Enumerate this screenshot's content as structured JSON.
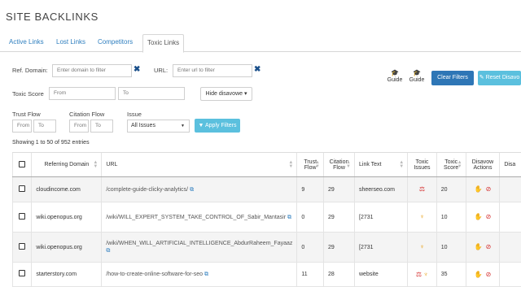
{
  "page_title": "SITE BACKLINKS",
  "tabs": [
    {
      "label": "Active Links",
      "active": false
    },
    {
      "label": "Lost Links",
      "active": false
    },
    {
      "label": "Competitors",
      "active": false
    },
    {
      "label": "Toxic Links",
      "active": true
    }
  ],
  "filters": {
    "ref_domain_label": "Ref. Domain:",
    "ref_domain_placeholder": "Enter domain to filter",
    "url_label": "URL:",
    "url_placeholder": "Enter url to filter",
    "toxic_score_label": "Toxic Score",
    "toxic_from_placeholder": "From",
    "toxic_to_placeholder": "To",
    "trust_flow_label": "Trust Flow",
    "citation_flow_label": "Citation Flow",
    "from_placeholder": "From",
    "to_placeholder": "To",
    "issue_label": "Issue",
    "issue_selected": "All Issues",
    "hide_disavowed_label": "Hide disavowe ▾",
    "apply_filters_label": "▼ Apply Filters"
  },
  "toolbar": {
    "guide1": "Guide",
    "guide2": "Guide",
    "clear_filters": "Clear Filters",
    "reset_disavow": "✎ Reset Disavo"
  },
  "entries_text": "Showing 1 to 50 of 952 entries",
  "table": {
    "headers": [
      "Referring Domain",
      "URL",
      "Trust Flow",
      "Citation Flow",
      "Link Text",
      "Toxic Issues",
      "Toxic Score",
      "Disavow Actions",
      "Disa"
    ],
    "rows": [
      {
        "domain": "cloudincome.com",
        "url": "/complete-guide-clicky-analytics/",
        "trust": "9",
        "citation": "29",
        "link_text": "sheerseo.com",
        "issues": [
          "⚖"
        ],
        "score": "20"
      },
      {
        "domain": "wiki.openopus.org",
        "url": "/wiki/WILL_EXPERT_SYSTEM_TAKE_CONTROL_OF_Sabir_Mantasir",
        "trust": "0",
        "citation": "29",
        "link_text": "[2731",
        "issues": [
          "♆"
        ],
        "score": "10"
      },
      {
        "domain": "wiki.openopus.org",
        "url": "/wiki/WHEN_WILL_ARTIFICIAL_INTELLIGENCE_AbdurRaheem_Fayaaz",
        "trust": "0",
        "citation": "29",
        "link_text": "[2731",
        "issues": [
          "♆"
        ],
        "score": "10"
      },
      {
        "domain": "starterstory.com",
        "url": "/how-to-create-online-software-for-seo",
        "trust": "11",
        "citation": "28",
        "link_text": "website",
        "issues": [
          "⚖",
          "♆"
        ],
        "score": "35"
      }
    ]
  },
  "colors": {
    "primary_button": "#2e76b6",
    "light_button": "#5bc0de",
    "link": "#2f7fbf",
    "hand_icon": "#e8a21a",
    "ban_icon": "#d43030",
    "toxic_icon": "#d43030"
  }
}
